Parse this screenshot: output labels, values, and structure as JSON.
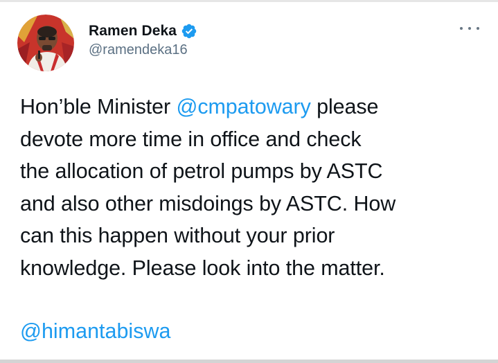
{
  "author": {
    "display_name": "Ramen Deka",
    "handle": "@ramendeka16",
    "verified": true,
    "verified_color": "#1d9bf0"
  },
  "menu": {
    "icon": "more-horizontal-icon"
  },
  "tweet": {
    "lines": [
      {
        "before": "Hon’ble Minister ",
        "mention": "@cmpatowary",
        "after": " please"
      },
      {
        "text": "devote more time in office and check"
      },
      {
        "text": "the allocation of petrol pumps by ASTC"
      },
      {
        "text": "and also other misdoings by ASTC. How"
      },
      {
        "text": "can this happen without your prior"
      },
      {
        "text": "knowledge. Please look into the matter."
      }
    ],
    "trailing_mention": "@himantabiswa"
  },
  "colors": {
    "text": "#0f1419",
    "secondary": "#5b7083",
    "link": "#1d9bf0"
  }
}
